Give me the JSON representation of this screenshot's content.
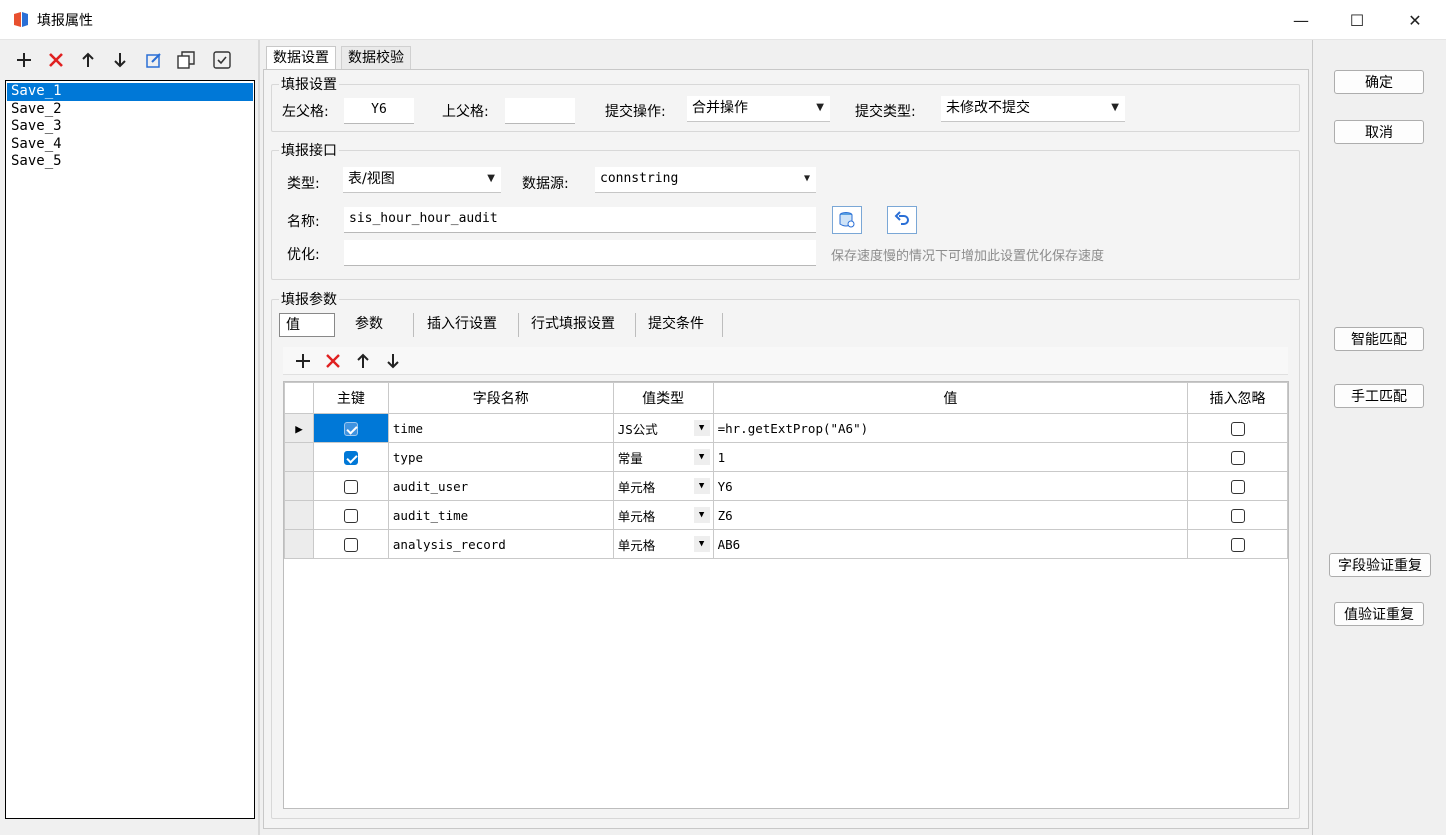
{
  "window": {
    "title": "填报属性",
    "controls": {
      "minimize": "—",
      "maximize": "☐",
      "close": "✕"
    }
  },
  "left_toolbar": {
    "icons": [
      "add-icon",
      "delete-icon",
      "move-up-icon",
      "move-down-icon",
      "edit-icon",
      "copy-icon",
      "check-icon"
    ]
  },
  "save_list": [
    "Save_1",
    "Save_2",
    "Save_3",
    "Save_4",
    "Save_5"
  ],
  "tabs": [
    "数据设置",
    "数据校验"
  ],
  "fill_settings": {
    "title": "填报设置",
    "left_parent_label": "左父格:",
    "left_parent_value": "Y6",
    "top_parent_label": "上父格:",
    "top_parent_value": "",
    "submit_op_label": "提交操作:",
    "submit_op_value": "合并操作",
    "submit_type_label": "提交类型:",
    "submit_type_value": "未修改不提交"
  },
  "interface": {
    "title": "填报接口",
    "type_label": "类型:",
    "type_value": "表/视图",
    "datasource_label": "数据源:",
    "datasource_value": "connstring",
    "name_label": "名称:",
    "name_value": "sis_hour_hour_audit",
    "optimize_label": "优化:",
    "optimize_value": "",
    "optimize_hint": "保存速度慢的情况下可增加此设置优化保存速度"
  },
  "params": {
    "title": "填报参数",
    "subtabs": [
      "值",
      "参数",
      "插入行设置",
      "行式填报设置",
      "提交条件"
    ],
    "columns": [
      "主键",
      "字段名称",
      "值类型",
      "值",
      "插入忽略"
    ],
    "rows": [
      {
        "pk": true,
        "field": "time",
        "vtype": "JS公式",
        "value": "=hr.getExtProp(\"A6\")",
        "ignore": false
      },
      {
        "pk": true,
        "field": "type",
        "vtype": "常量",
        "value": "1",
        "ignore": false
      },
      {
        "pk": false,
        "field": "audit_user",
        "vtype": "单元格",
        "value": "Y6",
        "ignore": false
      },
      {
        "pk": false,
        "field": "audit_time",
        "vtype": "单元格",
        "value": "Z6",
        "ignore": false
      },
      {
        "pk": false,
        "field": "analysis_record",
        "vtype": "单元格",
        "value": "AB6",
        "ignore": false
      }
    ]
  },
  "right_buttons": {
    "ok": "确定",
    "cancel": "取消",
    "smart_match": "智能匹配",
    "manual_match": "手工匹配",
    "field_dup": "字段验证重复",
    "value_dup": "值验证重复"
  },
  "colors": {
    "accent": "#0078d7",
    "delete": "#e02020",
    "hint": "#8c8c8c"
  }
}
